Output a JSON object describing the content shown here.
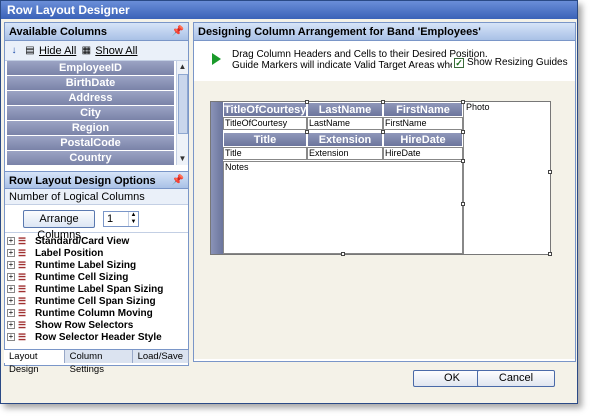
{
  "window": {
    "title": "Row Layout Designer"
  },
  "available_columns": {
    "title": "Available Columns",
    "toolbar": {
      "hide_all": "Hide All",
      "show_all": "Show All"
    },
    "items": [
      "EmployeeID",
      "BirthDate",
      "Address",
      "City",
      "Region",
      "PostalCode",
      "Country"
    ]
  },
  "options": {
    "title": "Row Layout Design Options",
    "number_label": "Number of Logical Columns",
    "arrange_label": "Arrange Columns",
    "columns_value": "1",
    "items": [
      "Standard/Card View",
      "Label Position",
      "Runtime Label Sizing",
      "Runtime Cell Sizing",
      "Runtime Label Span Sizing",
      "Runtime Cell Span Sizing",
      "Runtime Column Moving",
      "Show Row Selectors",
      "Row Selector Header Style"
    ]
  },
  "tabs": [
    "Layout Design",
    "Column Settings",
    "Load/Save"
  ],
  "design": {
    "title": "Designing Column Arrangement for Band 'Employees'",
    "instruction_line1": "Drag Column Headers and Cells to their Desired Position.",
    "instruction_line2": "Guide Markers will indicate Valid Target Areas where the Item",
    "show_guides": "Show Resizing Guides",
    "headers_row1": [
      "TitleOfCourtesy",
      "LastName",
      "FirstName"
    ],
    "cells_row1": [
      "TitleOfCourtesy",
      "LastName",
      "FirstName"
    ],
    "headers_row2": [
      "Title",
      "Extension",
      "HireDate"
    ],
    "cells_row2": [
      "Title",
      "Extension",
      "HireDate"
    ],
    "notes": "Notes",
    "photo": "Photo"
  },
  "buttons": {
    "ok": "OK",
    "cancel": "Cancel"
  }
}
